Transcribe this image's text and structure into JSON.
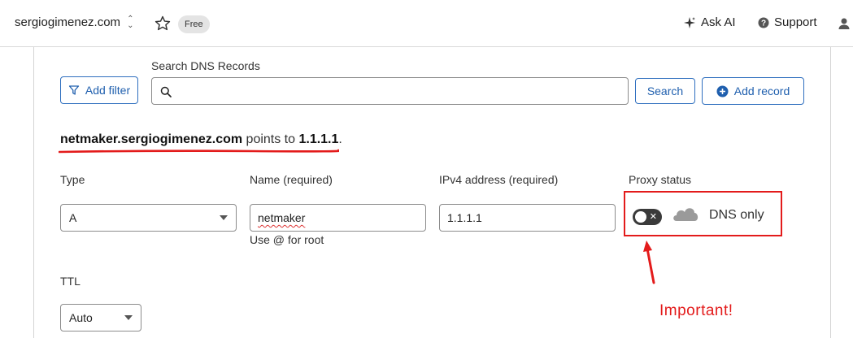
{
  "topbar": {
    "domain": "sergiogimenez.com",
    "plan_badge": "Free",
    "ask_ai": "Ask AI",
    "support": "Support"
  },
  "search": {
    "label": "Search DNS Records",
    "add_filter": "Add filter",
    "input_value": "",
    "search_button": "Search",
    "add_record": "Add record"
  },
  "record_summary": {
    "host": "netmaker.sergiogimenez.com",
    "middle": " points to ",
    "target": "1.1.1.1",
    "end": "."
  },
  "form": {
    "type_label": "Type",
    "type_value": "A",
    "name_label": "Name (required)",
    "name_value": "netmaker",
    "name_hint": "Use @ for root",
    "ipv4_label": "IPv4 address (required)",
    "ipv4_value": "1.1.1.1",
    "proxy_label": "Proxy status",
    "proxy_enabled": false,
    "proxy_text": "DNS only",
    "ttl_label": "TTL",
    "ttl_value": "Auto"
  },
  "annotation": {
    "text": "Important!",
    "color": "#e31b1b"
  },
  "colors": {
    "accent": "#1f5fae",
    "annotation_red": "#e31b1b"
  }
}
